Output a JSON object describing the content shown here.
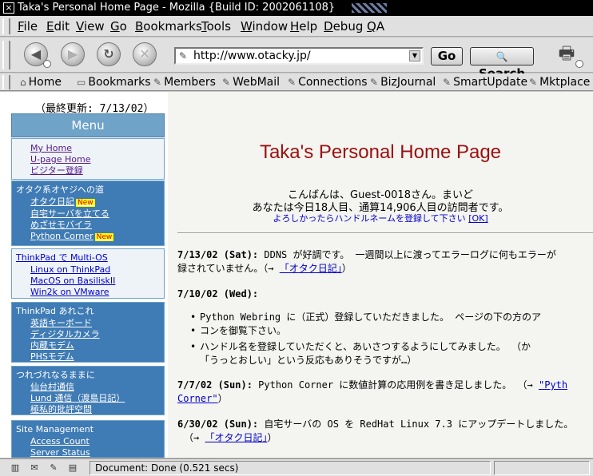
{
  "window": {
    "title": "Taka's Personal Home Page - Mozilla {Build ID: 2002061108}",
    "close_glyph": "×"
  },
  "menubar": {
    "items": [
      "File",
      "Edit",
      "View",
      "Go",
      "Bookmarks",
      "Tools",
      "Window",
      "Help",
      "Debug",
      "QA"
    ]
  },
  "navigation": {
    "back_glyph": "◀",
    "forward_glyph": "▶",
    "reload_glyph": "↻",
    "stop_glyph": "✕",
    "url": "http://www.otacky.jp/",
    "go_label": "Go",
    "search_label": "Search",
    "search_glyph": "🔍"
  },
  "personal_toolbar": {
    "items": [
      {
        "label": "Home",
        "icon": "house-icon",
        "glyph": "⌂"
      },
      {
        "label": "Bookmarks",
        "icon": "folder-icon",
        "glyph": "▭"
      },
      {
        "label": "Members",
        "icon": "bookmark-icon",
        "glyph": "✎"
      },
      {
        "label": "WebMail",
        "icon": "bookmark-icon",
        "glyph": "✎"
      },
      {
        "label": "Connections",
        "icon": "bookmark-icon",
        "glyph": "✎"
      },
      {
        "label": "BizJournal",
        "icon": "bookmark-icon",
        "glyph": "✎"
      },
      {
        "label": "SmartUpdate",
        "icon": "bookmark-icon",
        "glyph": "✎"
      },
      {
        "label": "Mktplace",
        "icon": "bookmark-icon",
        "glyph": "✎"
      }
    ]
  },
  "page": {
    "updated": "（最終更新: 7/13/02）",
    "menu_title": "Menu",
    "heading": "Taka's Personal Home Page",
    "greeting_1": "こんばんは、Guest-0018さん。まいど",
    "greeting_2": "あなたは今日18人目、通算14,906人目の訪問者です。",
    "greeting_3": "よろしかったらハンドルネームを登録して下さい",
    "greeting_ok": "[OK]",
    "new_badge": "New",
    "menu_sections": [
      {
        "title": "",
        "links": [
          "My Home",
          "U-page Home",
          "ビジター登録"
        ]
      },
      {
        "title": "オタク系オヤジへの道",
        "links": [
          "オタク日記",
          "自宅サーバを立てる",
          "めざせモバイラ",
          "Python Corner"
        ]
      },
      {
        "title": "ThinkPad で Multi-OS",
        "links": [
          "Linux on ThinkPad",
          "MacOS on BasiliskII",
          "Win2k on VMware"
        ]
      },
      {
        "title": "ThinkPad あれこれ",
        "links": [
          "英語キーボード",
          "ディジタルカメラ",
          "内蔵モデム",
          "PHSモデム"
        ]
      },
      {
        "title": "つれづれなるままに",
        "links": [
          "仙台村通信",
          "Lund 通信（渡島日記）",
          "極私的批評空間"
        ]
      },
      {
        "title": "Site Management",
        "links": [
          "Access Count",
          "Server Status"
        ]
      }
    ],
    "news": [
      {
        "date": "7/13/02 (Sat):",
        "text": " DDNS が好調です。 一週間以上に渡ってエラーログに何もエラーが",
        "text2": "録されていません。（→ ",
        "link": "「オタク日記」",
        "tail": "）"
      },
      {
        "date": "7/10/02 (Wed):",
        "text": ""
      },
      {
        "date": "7/7/02 (Sun):",
        "text": " Python Corner に数値計算の応用例を書き足しました。 （→ ",
        "link": "\"Pyth",
        "link2": "Corner\"",
        "tail": "）"
      },
      {
        "date": "6/30/02 (Sun):",
        "text": " 自宅サーバの OS を RedHat Linux 7.3 にアップデートしました。",
        "text2": "（→ ",
        "link": "「オタク日記」",
        "tail": "）"
      }
    ],
    "bullets": [
      {
        "text": "Python Webring に（正式）登録していただきました。 ページの下の方の",
        "link": "ア",
        "text2": "",
        "link2": "コン",
        "tail": "を御覧下さい。"
      },
      {
        "text": "ハンドル名を登録していただくと、あいさつするようにしてみました。 （か",
        "text2": "「うっとおしい」という反応もありそうですが…）"
      }
    ]
  },
  "status": {
    "text": "Document: Done (0.521 secs)",
    "icons": [
      "component-icon",
      "mail-icon",
      "composer-icon",
      "address-book-icon"
    ]
  }
}
